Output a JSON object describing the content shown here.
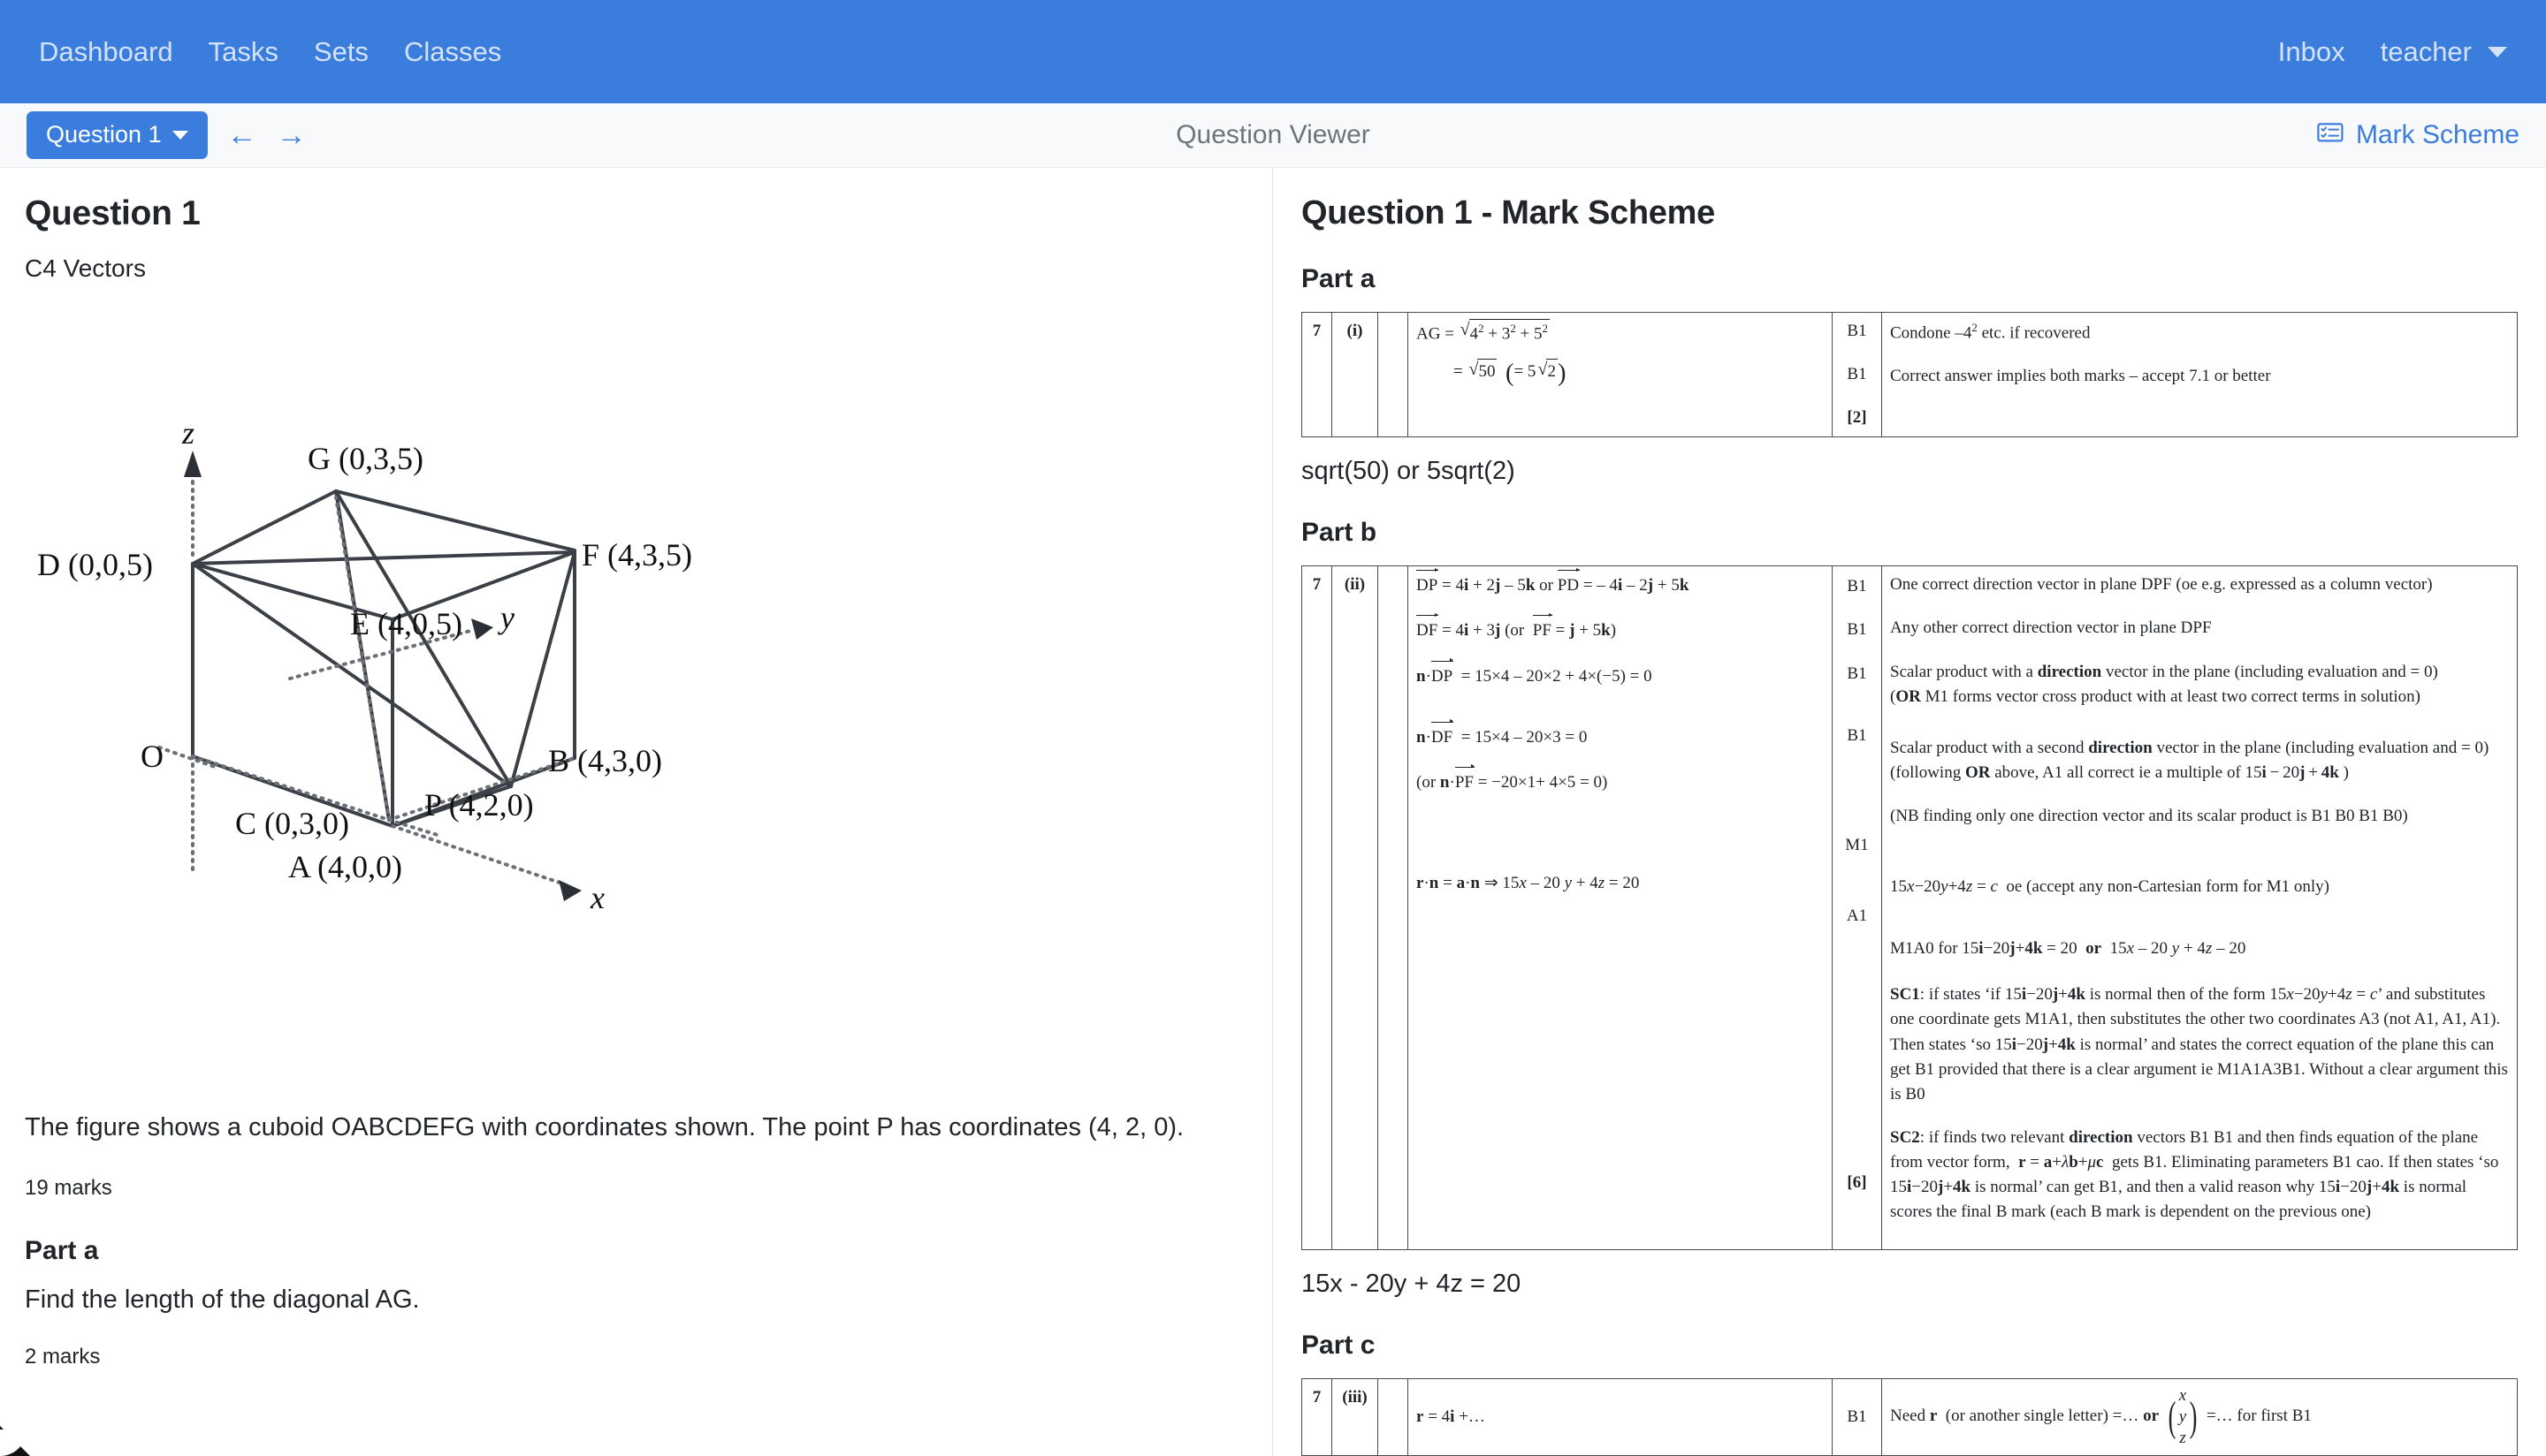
{
  "navbar": {
    "links": [
      "Dashboard",
      "Tasks",
      "Sets",
      "Classes"
    ],
    "inbox": "Inbox",
    "user": "teacher",
    "bg_color": "#3b7ddd"
  },
  "toolbar": {
    "question_button": "Question 1",
    "prev_arrow": "←",
    "next_arrow": "→",
    "title": "Question Viewer",
    "mark_scheme_label": "Mark Scheme",
    "accent_color": "#3b7ddd"
  },
  "question": {
    "title": "Question 1",
    "subtitle": "C4 Vectors",
    "body": "The figure shows a cuboid OABCDEFG with coordinates shown. The point P has coordinates (4, 2, 0).",
    "total_marks": "19 marks",
    "part_a_heading": "Part a",
    "part_a_text": "Find the length of the diagonal AG.",
    "part_a_marks": "2 marks"
  },
  "figure": {
    "axis_labels": {
      "x": "x",
      "y": "y",
      "z": "z"
    },
    "vertices": [
      {
        "id": "O",
        "label": "O"
      },
      {
        "id": "A",
        "label": "A (4,0,0)"
      },
      {
        "id": "B",
        "label": "B (4,3,0)"
      },
      {
        "id": "C",
        "label": "C (0,3,0)"
      },
      {
        "id": "D",
        "label": "D (0,0,5)"
      },
      {
        "id": "E",
        "label": "E (4,0,5)"
      },
      {
        "id": "F",
        "label": "F (4,3,5)"
      },
      {
        "id": "G",
        "label": "G (0,3,5)"
      },
      {
        "id": "P",
        "label": "P (4,2,0)"
      }
    ]
  },
  "markscheme": {
    "title": "Question 1 - Mark Scheme",
    "part_a": {
      "heading": "Part a",
      "answer": "sqrt(50) or 5sqrt(2)",
      "q": "7",
      "part": "(i)",
      "marks": [
        "B1",
        "B1"
      ],
      "total": "[2]",
      "notes": [
        "Condone –4² etc. if recovered",
        "Correct answer implies both marks – accept 7.1 or better"
      ],
      "working_line1": "AG = √(4² + 3² + 5²)",
      "working_line2": "= √50 (= 5√2)"
    },
    "part_b": {
      "heading": "Part b",
      "answer": "15x - 20y + 4z = 20",
      "q": "7",
      "part": "(ii)",
      "marks": [
        "B1",
        "B1",
        "B1",
        "B1",
        "M1",
        "A1"
      ],
      "total": "[6]",
      "working": [
        "DP = 4i + 2j – 5k or PD = – 4i – 2j + 5k",
        "DF = 4i + 3j (or PF = j + 5k)",
        "n·DP = 15×4 – 20×2 + 4×(−5) = 0",
        "n·DF = 15×4 – 20×3 = 0",
        "(or n·PF = −20×1 + 4×5 = 0)",
        "r·n = a·n ⇒ 15x – 20 y + 4z = 20"
      ],
      "notes": [
        "One correct direction vector in plane DPF (oe e.g. expressed as a column vector)",
        "Any other correct direction vector in plane DPF",
        "Scalar product with a direction vector in the plane (including evaluation and = 0) (OR M1 forms vector cross product with at least two correct terms in solution)",
        "Scalar product with a second direction vector in the plane (including evaluation and = 0) (following OR above, A1 all correct ie a multiple of 15i – 20j + 4k )",
        "(NB finding only one direction vector and its scalar product is B1 B0 B1 B0)",
        "15x – 20y + 4z = c oe (accept any non-Cartesian form for M1 only)",
        "M1A0 for 15i – 20j + 4k = 20 or 15x – 20 y + 4z – 20",
        "SC1: if states ‘if 15i – 20j + 4k is normal then of the form 15x – 20y + 4z = c’ and substitutes one coordinate gets M1A1, then substitutes the other two coordinates A3 (not A1, A1, A1). Then states ‘so 15i – 20j + 4k is normal’ and states the correct equation of the plane this can get B1 provided that there is a clear argument ie M1A1A3B1. Without a clear argument this is B0",
        "SC2: if finds two relevant direction vectors B1 B1 and then finds equation of the plane from vector form, r = a + λb + μc gets B1. Eliminating parameters B1 cao. If then states ‘so 15i – 20j + 4k is normal’ can get B1, and then a valid reason why 15i – 20j + 4k is normal scores the final B mark (each B mark is dependent on the previous one)"
      ]
    },
    "part_c": {
      "heading": "Part c",
      "q": "7",
      "part": "(iii)",
      "working": "r = 4i +…",
      "mark": "B1",
      "note": "Need r (or another single letter) =… or (x y z) =… for first B1"
    }
  }
}
